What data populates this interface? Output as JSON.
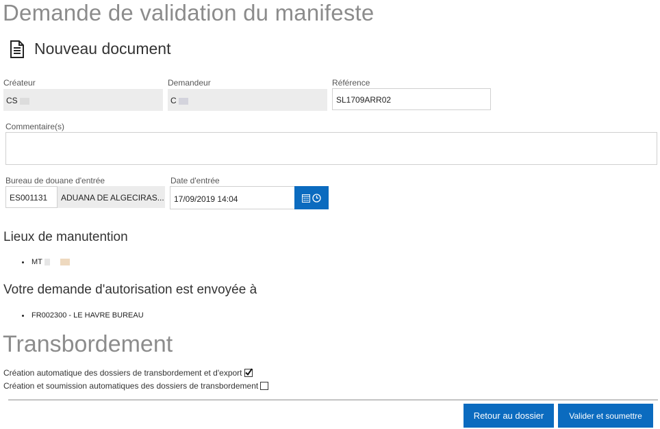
{
  "page": {
    "title": "Demande de validation du manifeste",
    "document_title": "Nouveau document",
    "document_icon": "document-icon"
  },
  "form": {
    "createur": {
      "label": "Créateur",
      "value": "CS"
    },
    "demandeur": {
      "label": "Demandeur",
      "value": "C"
    },
    "reference": {
      "label": "Référence",
      "value": "SL1709ARR02"
    },
    "commentaire": {
      "label": "Commentaire(s)",
      "value": ""
    },
    "bureau": {
      "label": "Bureau de douane d'entrée",
      "code": "ES001131",
      "name": "ADUANA DE ALGECIRAS..."
    },
    "date_entree": {
      "label": "Date d'entrée",
      "value": "17/09/2019 14:04",
      "picker_icons": [
        "calendar-icon",
        "clock-icon"
      ]
    }
  },
  "lieux": {
    "heading": "Lieux de manutention",
    "items": [
      "MT"
    ]
  },
  "envoi": {
    "heading": "Votre demande d'autorisation est envoyée à",
    "items": [
      "FR002300 - LE HAVRE BUREAU"
    ]
  },
  "transbordement": {
    "heading": "Transbordement",
    "options": [
      {
        "label": "Création automatique des dossiers de transbordement et d'export",
        "checked": true
      },
      {
        "label": "Création et soumission automatiques des dossiers de transbordement",
        "checked": false
      }
    ]
  },
  "actions": {
    "retour": "Retour au dossier",
    "valider": "Valider et soumettre"
  },
  "colors": {
    "accent": "#0b6bbf",
    "title_grey": "#8c8c8c",
    "readonly_bg": "#ececec"
  }
}
